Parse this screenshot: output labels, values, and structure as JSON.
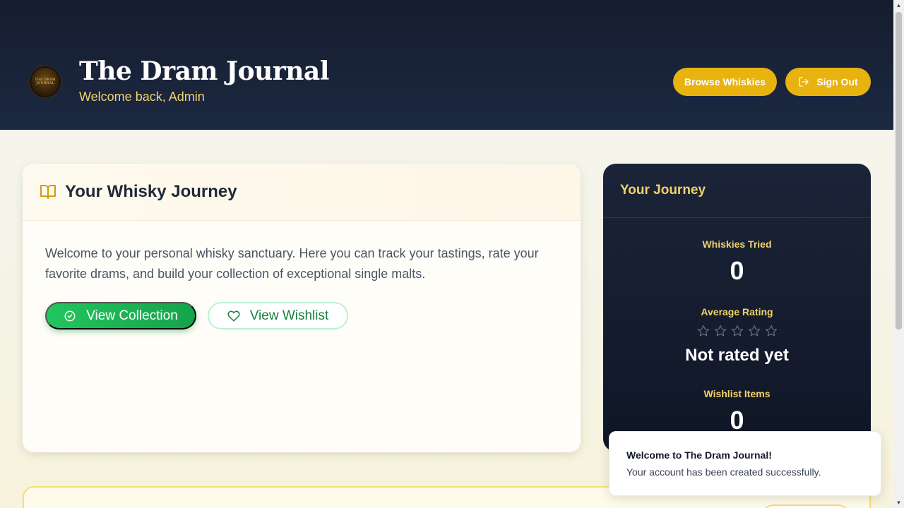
{
  "header": {
    "logo_text": "THE DRAM JOURNAL",
    "title": "The Dram Journal",
    "subtitle": "Welcome back, Admin",
    "browse_label": "Browse Whiskies",
    "signout_label": "Sign Out"
  },
  "journey_card": {
    "title": "Your Whisky Journey",
    "description": "Welcome to your personal whisky sanctuary. Here you can track your tastings, rate your favorite drams, and build your collection of exceptional single malts.",
    "collection_label": "View Collection",
    "wishlist_label": "View Wishlist"
  },
  "stats": {
    "title": "Your Journey",
    "tried_label": "Whiskies Tried",
    "tried_value": "0",
    "rating_label": "Average Rating",
    "rating_stars": 0,
    "rating_max": 5,
    "rating_text": "Not rated yet",
    "wishlist_label": "Wishlist Items",
    "wishlist_value": "0"
  },
  "toast": {
    "title": "Welcome to The Dram Journal!",
    "message": "Your account has been created successfully."
  },
  "colors": {
    "header_bg": "#151c2e",
    "accent_gold": "#e8b20f",
    "gold_text": "#f2d26b",
    "green": "#22c55e"
  },
  "icons": {
    "signout": "sign-out-icon",
    "book": "book-open-icon",
    "check": "check-circle-icon",
    "heart": "heart-icon",
    "star": "star-icon"
  }
}
